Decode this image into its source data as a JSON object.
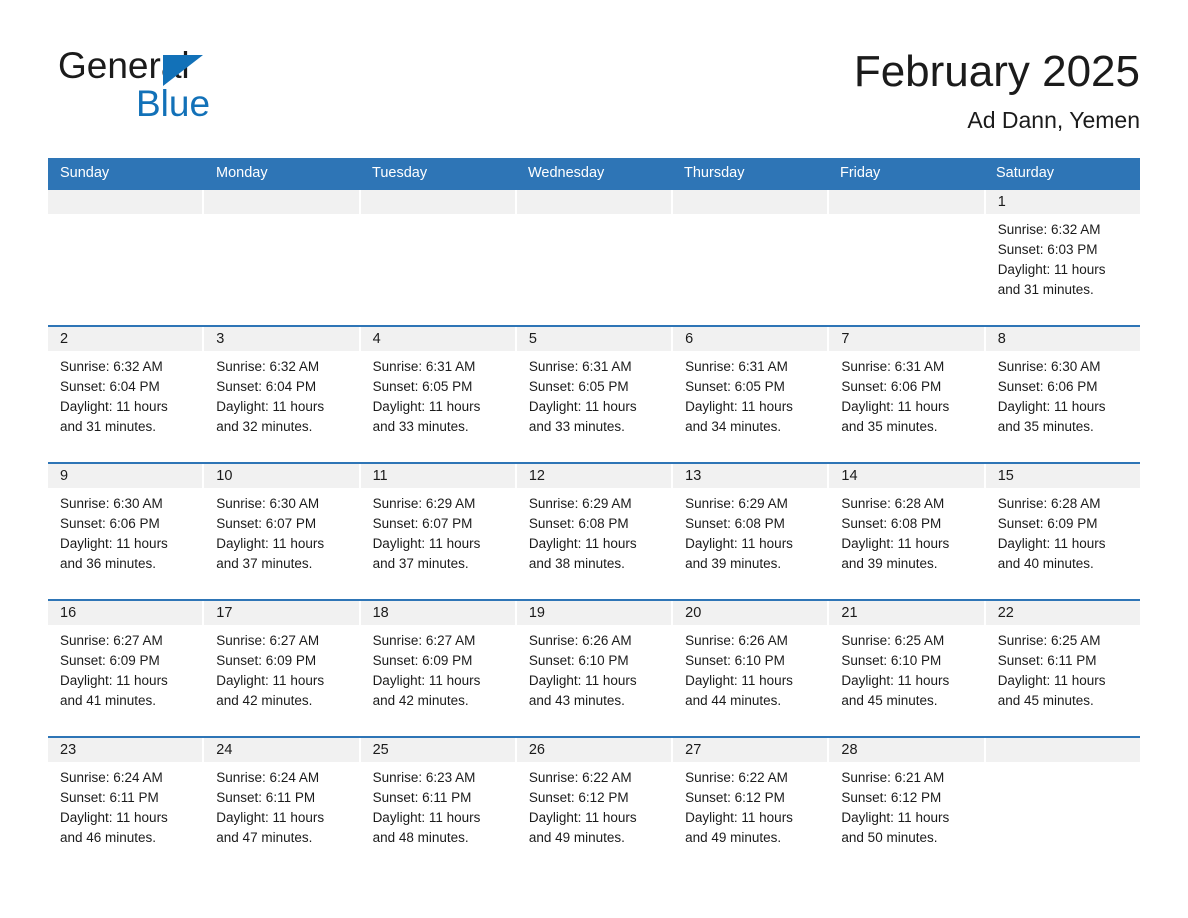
{
  "brand": {
    "word1": "General",
    "word2": "Blue",
    "triangle_icon": "triangle-icon",
    "accent_color": "#1271b8"
  },
  "header": {
    "title": "February 2025",
    "location": "Ad Dann, Yemen"
  },
  "theme": {
    "header_blue": "#2e75b6",
    "band_gray": "#f1f1f1",
    "text": "#1b1b1b"
  },
  "weekdays": [
    "Sunday",
    "Monday",
    "Tuesday",
    "Wednesday",
    "Thursday",
    "Friday",
    "Saturday"
  ],
  "weeks": [
    [
      {
        "day": "",
        "sunrise": "",
        "sunset": "",
        "daylight1": "",
        "daylight2": ""
      },
      {
        "day": "",
        "sunrise": "",
        "sunset": "",
        "daylight1": "",
        "daylight2": ""
      },
      {
        "day": "",
        "sunrise": "",
        "sunset": "",
        "daylight1": "",
        "daylight2": ""
      },
      {
        "day": "",
        "sunrise": "",
        "sunset": "",
        "daylight1": "",
        "daylight2": ""
      },
      {
        "day": "",
        "sunrise": "",
        "sunset": "",
        "daylight1": "",
        "daylight2": ""
      },
      {
        "day": "",
        "sunrise": "",
        "sunset": "",
        "daylight1": "",
        "daylight2": ""
      },
      {
        "day": "1",
        "sunrise": "Sunrise: 6:32 AM",
        "sunset": "Sunset: 6:03 PM",
        "daylight1": "Daylight: 11 hours",
        "daylight2": "and 31 minutes."
      }
    ],
    [
      {
        "day": "2",
        "sunrise": "Sunrise: 6:32 AM",
        "sunset": "Sunset: 6:04 PM",
        "daylight1": "Daylight: 11 hours",
        "daylight2": "and 31 minutes."
      },
      {
        "day": "3",
        "sunrise": "Sunrise: 6:32 AM",
        "sunset": "Sunset: 6:04 PM",
        "daylight1": "Daylight: 11 hours",
        "daylight2": "and 32 minutes."
      },
      {
        "day": "4",
        "sunrise": "Sunrise: 6:31 AM",
        "sunset": "Sunset: 6:05 PM",
        "daylight1": "Daylight: 11 hours",
        "daylight2": "and 33 minutes."
      },
      {
        "day": "5",
        "sunrise": "Sunrise: 6:31 AM",
        "sunset": "Sunset: 6:05 PM",
        "daylight1": "Daylight: 11 hours",
        "daylight2": "and 33 minutes."
      },
      {
        "day": "6",
        "sunrise": "Sunrise: 6:31 AM",
        "sunset": "Sunset: 6:05 PM",
        "daylight1": "Daylight: 11 hours",
        "daylight2": "and 34 minutes."
      },
      {
        "day": "7",
        "sunrise": "Sunrise: 6:31 AM",
        "sunset": "Sunset: 6:06 PM",
        "daylight1": "Daylight: 11 hours",
        "daylight2": "and 35 minutes."
      },
      {
        "day": "8",
        "sunrise": "Sunrise: 6:30 AM",
        "sunset": "Sunset: 6:06 PM",
        "daylight1": "Daylight: 11 hours",
        "daylight2": "and 35 minutes."
      }
    ],
    [
      {
        "day": "9",
        "sunrise": "Sunrise: 6:30 AM",
        "sunset": "Sunset: 6:06 PM",
        "daylight1": "Daylight: 11 hours",
        "daylight2": "and 36 minutes."
      },
      {
        "day": "10",
        "sunrise": "Sunrise: 6:30 AM",
        "sunset": "Sunset: 6:07 PM",
        "daylight1": "Daylight: 11 hours",
        "daylight2": "and 37 minutes."
      },
      {
        "day": "11",
        "sunrise": "Sunrise: 6:29 AM",
        "sunset": "Sunset: 6:07 PM",
        "daylight1": "Daylight: 11 hours",
        "daylight2": "and 37 minutes."
      },
      {
        "day": "12",
        "sunrise": "Sunrise: 6:29 AM",
        "sunset": "Sunset: 6:08 PM",
        "daylight1": "Daylight: 11 hours",
        "daylight2": "and 38 minutes."
      },
      {
        "day": "13",
        "sunrise": "Sunrise: 6:29 AM",
        "sunset": "Sunset: 6:08 PM",
        "daylight1": "Daylight: 11 hours",
        "daylight2": "and 39 minutes."
      },
      {
        "day": "14",
        "sunrise": "Sunrise: 6:28 AM",
        "sunset": "Sunset: 6:08 PM",
        "daylight1": "Daylight: 11 hours",
        "daylight2": "and 39 minutes."
      },
      {
        "day": "15",
        "sunrise": "Sunrise: 6:28 AM",
        "sunset": "Sunset: 6:09 PM",
        "daylight1": "Daylight: 11 hours",
        "daylight2": "and 40 minutes."
      }
    ],
    [
      {
        "day": "16",
        "sunrise": "Sunrise: 6:27 AM",
        "sunset": "Sunset: 6:09 PM",
        "daylight1": "Daylight: 11 hours",
        "daylight2": "and 41 minutes."
      },
      {
        "day": "17",
        "sunrise": "Sunrise: 6:27 AM",
        "sunset": "Sunset: 6:09 PM",
        "daylight1": "Daylight: 11 hours",
        "daylight2": "and 42 minutes."
      },
      {
        "day": "18",
        "sunrise": "Sunrise: 6:27 AM",
        "sunset": "Sunset: 6:09 PM",
        "daylight1": "Daylight: 11 hours",
        "daylight2": "and 42 minutes."
      },
      {
        "day": "19",
        "sunrise": "Sunrise: 6:26 AM",
        "sunset": "Sunset: 6:10 PM",
        "daylight1": "Daylight: 11 hours",
        "daylight2": "and 43 minutes."
      },
      {
        "day": "20",
        "sunrise": "Sunrise: 6:26 AM",
        "sunset": "Sunset: 6:10 PM",
        "daylight1": "Daylight: 11 hours",
        "daylight2": "and 44 minutes."
      },
      {
        "day": "21",
        "sunrise": "Sunrise: 6:25 AM",
        "sunset": "Sunset: 6:10 PM",
        "daylight1": "Daylight: 11 hours",
        "daylight2": "and 45 minutes."
      },
      {
        "day": "22",
        "sunrise": "Sunrise: 6:25 AM",
        "sunset": "Sunset: 6:11 PM",
        "daylight1": "Daylight: 11 hours",
        "daylight2": "and 45 minutes."
      }
    ],
    [
      {
        "day": "23",
        "sunrise": "Sunrise: 6:24 AM",
        "sunset": "Sunset: 6:11 PM",
        "daylight1": "Daylight: 11 hours",
        "daylight2": "and 46 minutes."
      },
      {
        "day": "24",
        "sunrise": "Sunrise: 6:24 AM",
        "sunset": "Sunset: 6:11 PM",
        "daylight1": "Daylight: 11 hours",
        "daylight2": "and 47 minutes."
      },
      {
        "day": "25",
        "sunrise": "Sunrise: 6:23 AM",
        "sunset": "Sunset: 6:11 PM",
        "daylight1": "Daylight: 11 hours",
        "daylight2": "and 48 minutes."
      },
      {
        "day": "26",
        "sunrise": "Sunrise: 6:22 AM",
        "sunset": "Sunset: 6:12 PM",
        "daylight1": "Daylight: 11 hours",
        "daylight2": "and 49 minutes."
      },
      {
        "day": "27",
        "sunrise": "Sunrise: 6:22 AM",
        "sunset": "Sunset: 6:12 PM",
        "daylight1": "Daylight: 11 hours",
        "daylight2": "and 49 minutes."
      },
      {
        "day": "28",
        "sunrise": "Sunrise: 6:21 AM",
        "sunset": "Sunset: 6:12 PM",
        "daylight1": "Daylight: 11 hours",
        "daylight2": "and 50 minutes."
      },
      {
        "day": "",
        "sunrise": "",
        "sunset": "",
        "daylight1": "",
        "daylight2": ""
      }
    ]
  ]
}
